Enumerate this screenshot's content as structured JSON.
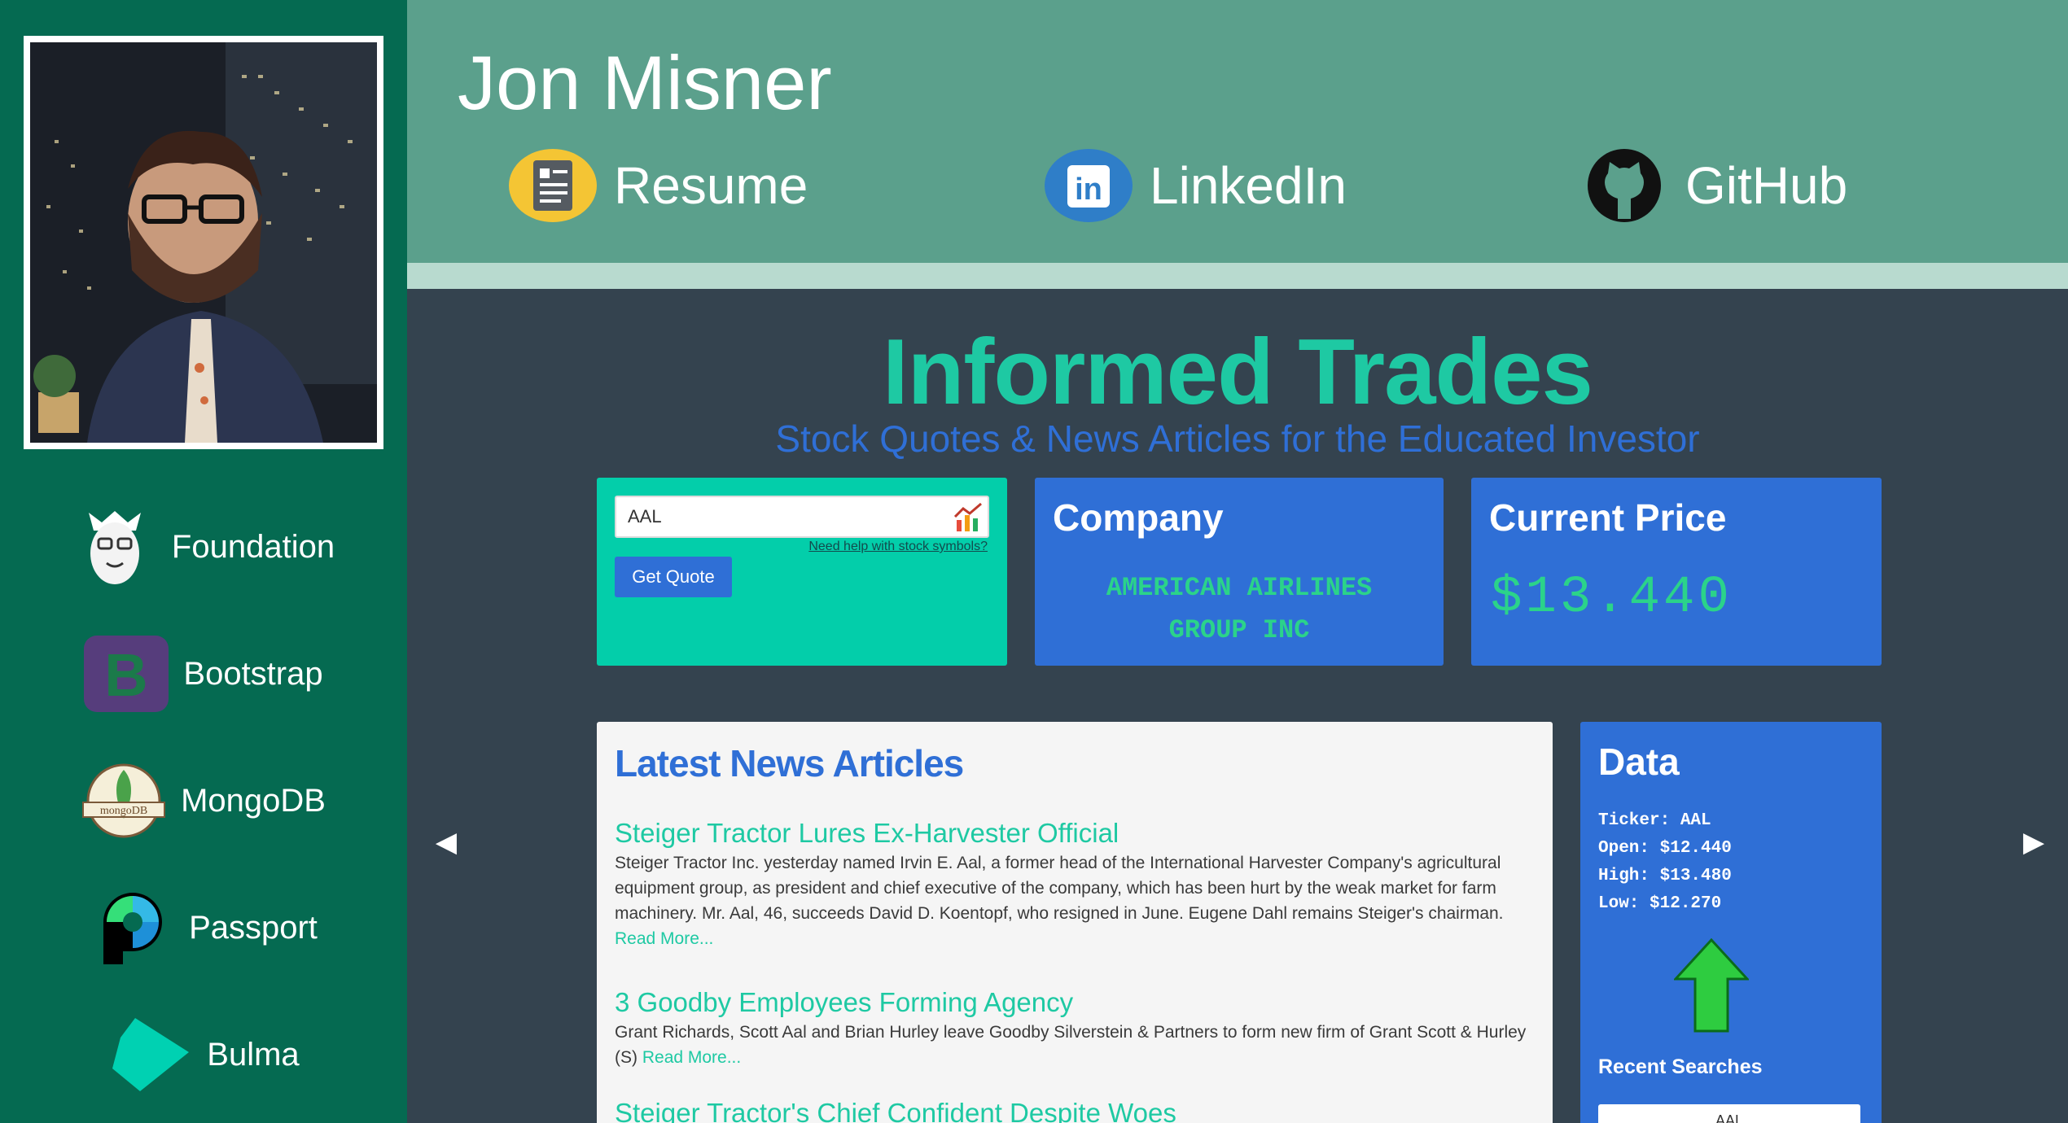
{
  "header": {
    "name": "Jon Misner",
    "links": [
      {
        "label": "Resume",
        "icon": "resume-icon"
      },
      {
        "label": "LinkedIn",
        "icon": "linkedin-icon"
      },
      {
        "label": "GitHub",
        "icon": "github-icon"
      }
    ]
  },
  "sidebar": {
    "technologies": [
      {
        "label": "Foundation",
        "icon": "foundation-icon"
      },
      {
        "label": "Bootstrap",
        "icon": "bootstrap-icon"
      },
      {
        "label": "MongoDB",
        "icon": "mongodb-icon"
      },
      {
        "label": "Passport",
        "icon": "passport-icon"
      },
      {
        "label": "Bulma",
        "icon": "bulma-icon"
      }
    ]
  },
  "main": {
    "title": "Informed Trades",
    "subtitle": "Stock Quotes & News Articles for the Educated Investor"
  },
  "quote_form": {
    "symbol_value": "AAL",
    "help_link": "Need help with stock symbols?",
    "button_label": "Get Quote"
  },
  "company_card": {
    "title": "Company",
    "name": "AMERICAN AIRLINES GROUP INC"
  },
  "price_card": {
    "title": "Current Price",
    "price": "$13.440"
  },
  "news": {
    "heading": "Latest News Articles",
    "read_more": "Read More...",
    "articles": [
      {
        "title": "Steiger Tractor Lures Ex-Harvester Official",
        "body": "Steiger Tractor Inc. yesterday named Irvin E. Aal, a former head of the International Harvester Company's agricultural equipment group, as president and chief executive of the company, which has been hurt by the weak market for farm machinery. Mr. Aal, 46, succeeds David D. Koentopf, who resigned in June. Eugene Dahl remains Steiger's chairman."
      },
      {
        "title": "3 Goodby Employees Forming Agency",
        "body": "Grant Richards, Scott Aal and Brian Hurley leave Goodby Silverstein & Partners to form new firm of Grant Scott & Hurley (S)"
      },
      {
        "title": "Steiger Tractor's Chief Confident Despite Woes",
        "body": ""
      }
    ]
  },
  "data_card": {
    "title": "Data",
    "ticker": "Ticker: AAL",
    "open": "Open: $12.440",
    "high": "High: $13.480",
    "low": "Low: $12.270",
    "trend": "up-arrow-icon",
    "recent_title": "Recent Searches",
    "recent": [
      "AAL"
    ]
  },
  "nav": {
    "prev": "◀",
    "next": "▶"
  },
  "colors": {
    "sidebar": "#056a51",
    "header": "#5ba08c",
    "background": "#34434f",
    "accent_teal": "#1ec9a3",
    "accent_blue": "#2f6fd6",
    "price_green": "#2bd38a"
  }
}
